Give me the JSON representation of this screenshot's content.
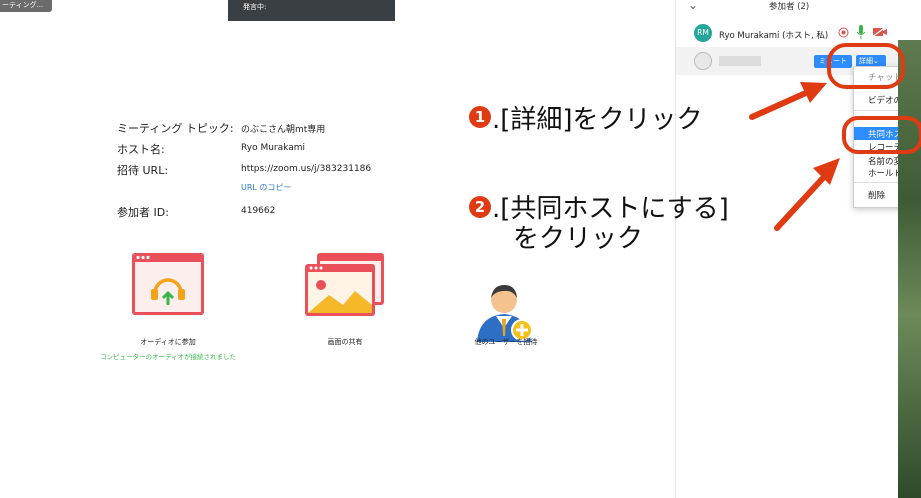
{
  "top_tag": "ーティング...",
  "speaking_label": "発言中:",
  "meeting": {
    "topic_label": "ミーティング トピック:",
    "topic_value": "のぶこさん朝mt専用",
    "host_label": "ホスト名:",
    "host_value": "Ryo Murakami",
    "url_label": "招待 URL:",
    "url_value": "https://zoom.us/j/383231186",
    "copy_url": "URL のコピー",
    "id_label": "参加者 ID:",
    "id_value": "419662"
  },
  "actions": {
    "audio": {
      "label": "オーディオに参加",
      "sub": "コンピューターのオーディオが接続されました"
    },
    "share": {
      "label": "画面の共有"
    },
    "invite": {
      "label": "他のユーザーを招待"
    }
  },
  "panel": {
    "chevron": "⌄",
    "title": "参加者 (2)",
    "host_participant": {
      "initials": "RM",
      "name": "Ryo Murakami (ホスト, 私)"
    },
    "mute_button": "ミュート",
    "details_button": "詳細",
    "menu": [
      "チャット",
      "ビデオの開始",
      "共同ホストにする",
      "レコーディング",
      "名前の変更",
      "ホールド状態",
      "削除"
    ]
  },
  "annotations": {
    "step1_num": "1",
    "step1": ".[詳細]をクリック",
    "step2_num": "2",
    "step2_line1": ".[共同ホストにする]",
    "step2_line2": "をクリック"
  },
  "colors": {
    "accent_red": "#e03a12",
    "link_blue": "#2d7cd6",
    "zoom_blue": "#2d8cff",
    "ok_green": "#3bb54a"
  }
}
